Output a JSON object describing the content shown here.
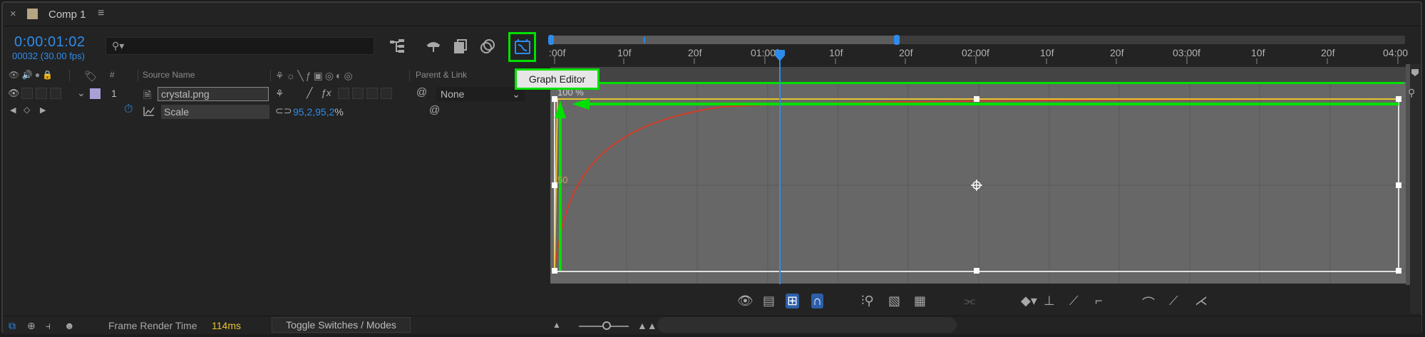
{
  "tab": {
    "close": "×",
    "title": "Comp 1",
    "menu": "≡"
  },
  "timecode": {
    "current": "0:00:01:02",
    "frames_fps": "00032 (30.00 fps)"
  },
  "search": {
    "placeholder": ""
  },
  "columns": {
    "hash": "#",
    "source_name": "Source Name",
    "parent_link": "Parent & Link"
  },
  "layer": {
    "index": "1",
    "name": "crystal.png",
    "parent": "None"
  },
  "property": {
    "name": "Scale",
    "value": "95,2,95,2",
    "unit": "%"
  },
  "graph_editor": {
    "tooltip": "Graph Editor",
    "y_label_top": "100 %",
    "y_label_mid": "50"
  },
  "ruler": {
    "labels": [
      ":00f",
      "10f",
      "20f",
      "01:00f",
      "10f",
      "20f",
      "02:00f",
      "10f",
      "20f",
      "03:00f",
      "10f",
      "20f",
      "04:00"
    ]
  },
  "status": {
    "frame_render_label": "Frame Render Time",
    "frame_render_value": "114ms",
    "toggle_label": "Toggle Switches / Modes"
  },
  "colors": {
    "accent": "#2d8ceb",
    "highlight": "#00e000",
    "curve_yellow": "#e8c230",
    "curve_red": "#d23c28",
    "frame_time": "#e8c230"
  }
}
